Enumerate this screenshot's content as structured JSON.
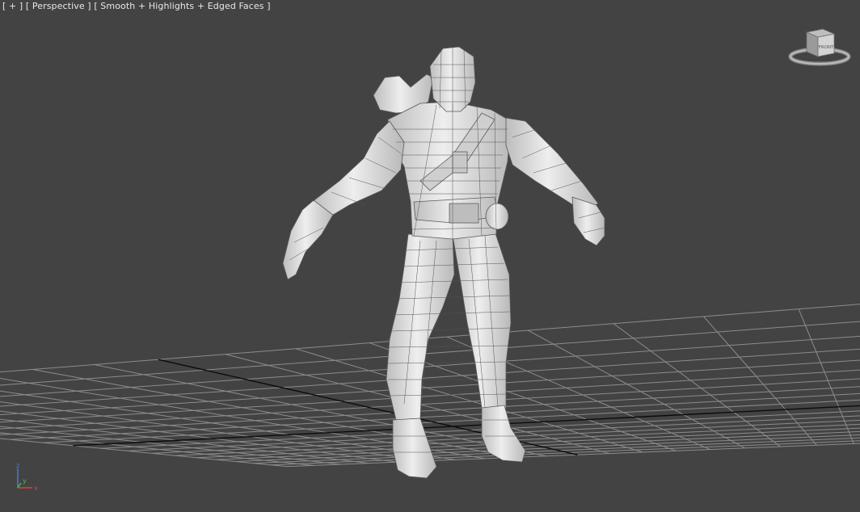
{
  "viewport": {
    "label_plus": "[ + ]",
    "label_view": "[ Perspective ]",
    "label_shading": "[ Smooth + Highlights + Edged Faces ]",
    "background_color": "#434343",
    "grid_color": "#8c8c8c",
    "grid_axis_color": "#0c0c0c",
    "mesh_color": "#dcdcdc",
    "wire_color": "#555555"
  },
  "viewcube": {
    "face_label": "FRONT",
    "icon": "viewcube-icon"
  },
  "axis_tripod": {
    "x_label": "x",
    "y_label": "y",
    "z_label": "z",
    "x_color": "#e04040",
    "y_color": "#40c040",
    "z_color": "#4a7ad8"
  }
}
